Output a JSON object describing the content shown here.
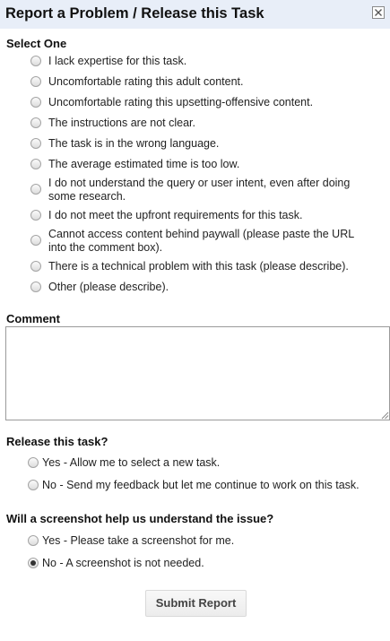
{
  "header": {
    "title": "Report a Problem / Release this Task"
  },
  "select_one": {
    "label": "Select One",
    "options": [
      {
        "line1": "I lack expertise for this task.",
        "line2": ""
      },
      {
        "line1": "Uncomfortable rating this adult content.",
        "line2": ""
      },
      {
        "line1": "Uncomfortable rating this upsetting-offensive content.",
        "line2": ""
      },
      {
        "line1": "The instructions are not clear.",
        "line2": ""
      },
      {
        "line1": "The task is in the wrong language.",
        "line2": ""
      },
      {
        "line1": "The average estimated time is too low.",
        "line2": ""
      },
      {
        "line1": "I do not understand the query or user intent, even after doing",
        "line2": "some research."
      },
      {
        "line1": "I do not meet the upfront requirements for this task.",
        "line2": ""
      },
      {
        "line1": "Cannot access content behind paywall (please paste the URL",
        "line2": "into the comment box)."
      },
      {
        "line1": "There is a technical problem with this task (please describe).",
        "line2": ""
      },
      {
        "line1": "Other (please describe).",
        "line2": ""
      }
    ]
  },
  "comment": {
    "label": "Comment",
    "value": ""
  },
  "release": {
    "label": "Release this task?",
    "options": [
      {
        "text": "Yes - Allow me to select a new task.",
        "checked": false
      },
      {
        "text": "No - Send my feedback but let me continue to work on this task.",
        "checked": false
      }
    ]
  },
  "screenshot": {
    "label": "Will a screenshot help us understand the issue?",
    "options": [
      {
        "text": "Yes - Please take a screenshot for me.",
        "checked": false
      },
      {
        "text": "No - A screenshot is not needed.",
        "checked": true
      }
    ]
  },
  "submit": {
    "label": "Submit Report"
  }
}
